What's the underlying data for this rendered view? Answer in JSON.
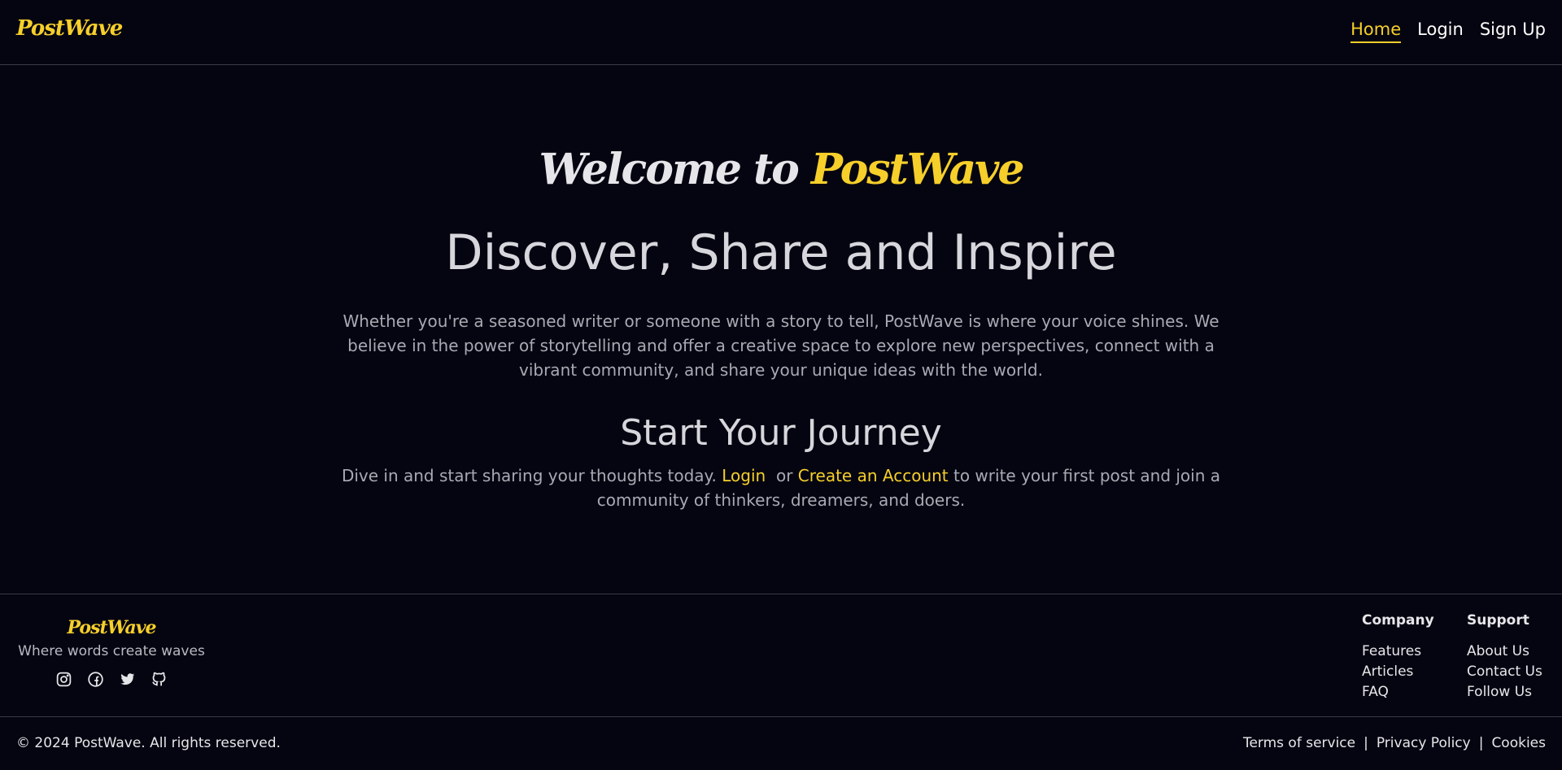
{
  "header": {
    "logo": "PostWave",
    "nav": [
      {
        "label": "Home",
        "active": true
      },
      {
        "label": "Login",
        "active": false
      },
      {
        "label": "Sign Up",
        "active": false
      }
    ]
  },
  "hero": {
    "welcome_prefix": "Welcome to",
    "welcome_brand": "PostWave",
    "tagline": "Discover, Share and Inspire",
    "intro": "Whether you're a seasoned writer or someone with a story to tell, PostWave is where your voice shines. We believe in the power of storytelling and offer a creative space to explore new perspectives, connect with a vibrant community, and share your unique ideas with the world.",
    "journey_title": "Start Your Journey",
    "cta_before": "Dive in and start sharing your thoughts today.",
    "cta_login": "Login",
    "cta_or": "or",
    "cta_create": "Create an Account",
    "cta_after": "to write your first post and join a community of thinkers, dreamers, and doers."
  },
  "footer": {
    "logo": "PostWave",
    "tagline": "Where words create waves",
    "socials": [
      "instagram-icon",
      "facebook-icon",
      "twitter-icon",
      "github-icon"
    ],
    "company": {
      "title": "Company",
      "links": [
        "Features",
        "Articles",
        "FAQ"
      ]
    },
    "support": {
      "title": "Support",
      "links": [
        "About Us",
        "Contact Us",
        "Follow Us"
      ]
    },
    "copyright": "© 2024 PostWave. All rights reserved.",
    "legal": [
      "Terms of service",
      "Privacy Policy",
      "Cookies"
    ],
    "legal_separator": "|"
  },
  "colors": {
    "background": "#050511",
    "accent": "#f6cf2a",
    "text": "#e7e7ea",
    "muted": "#a9a9b3"
  }
}
